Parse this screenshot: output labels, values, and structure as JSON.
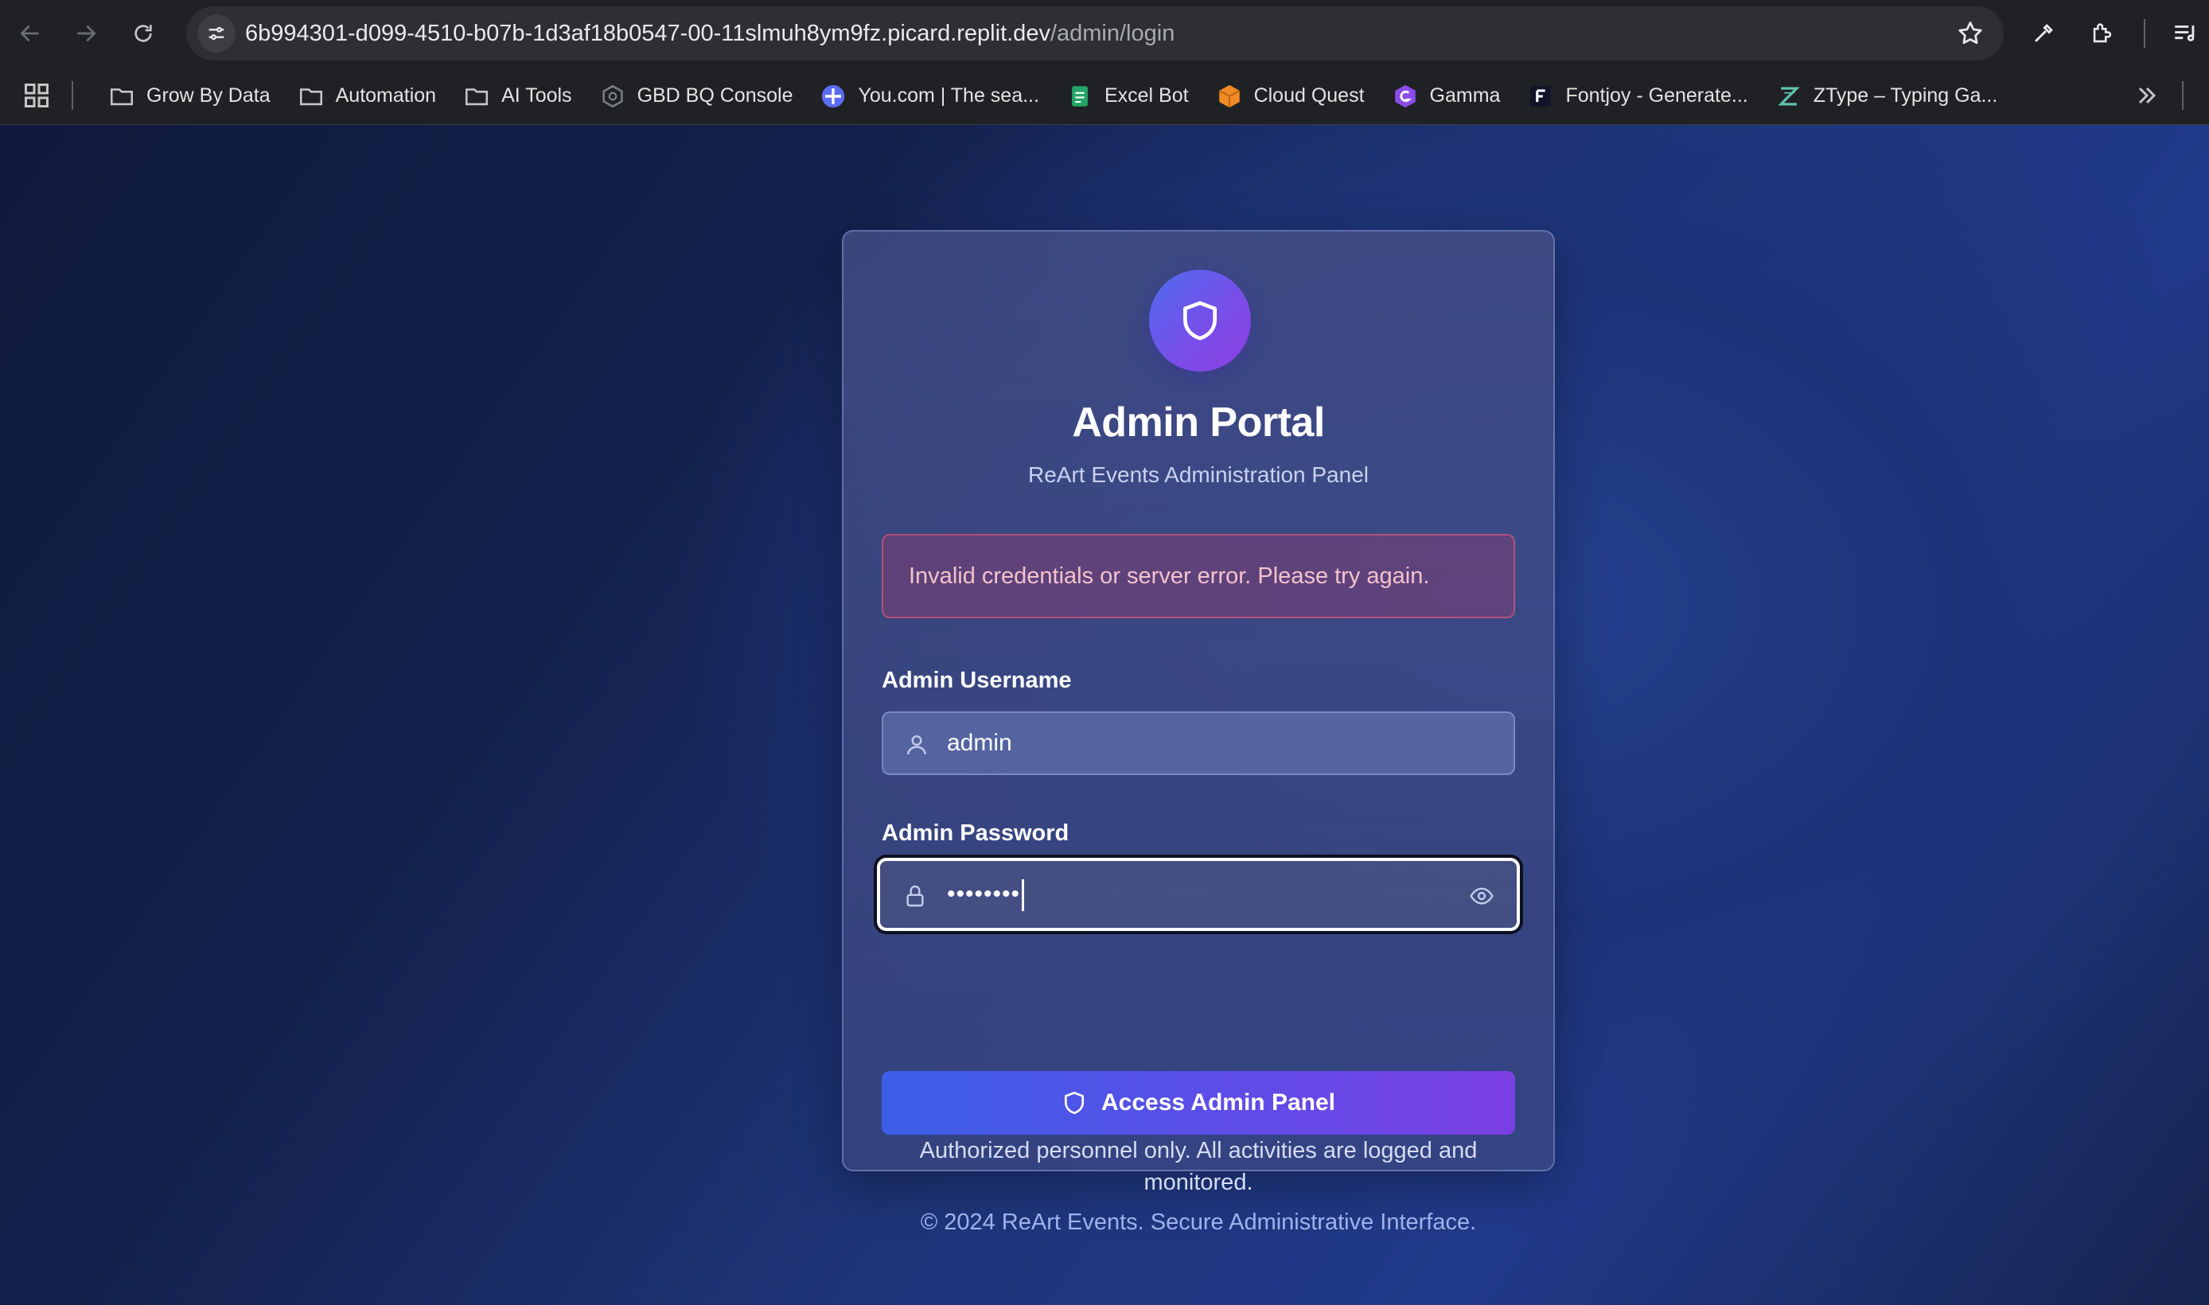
{
  "browser": {
    "url_host": "6b994301-d099-4510-b07b-1d3af18b0547-00-11slmuh8ym9fz.picard.replit.dev",
    "url_path": "/admin/login",
    "bookmarks": [
      {
        "label": "Grow By Data",
        "icon": "folder-icon"
      },
      {
        "label": "Automation",
        "icon": "folder-icon"
      },
      {
        "label": "AI Tools",
        "icon": "folder-icon"
      },
      {
        "label": "GBD BQ Console",
        "icon": "bigquery-icon"
      },
      {
        "label": "You.com | The sea...",
        "icon": "youcom-icon"
      },
      {
        "label": "Excel Bot",
        "icon": "sheet-icon"
      },
      {
        "label": "Cloud Quest",
        "icon": "cube-icon"
      },
      {
        "label": "Gamma",
        "icon": "gamma-icon"
      },
      {
        "label": "Fontjoy - Generate...",
        "icon": "fontjoy-icon"
      },
      {
        "label": "ZType – Typing Ga...",
        "icon": "ztype-icon"
      }
    ]
  },
  "login": {
    "title": "Admin Portal",
    "subtitle": "ReArt Events Administration Panel",
    "error": "Invalid credentials or server error. Please try again.",
    "username_label": "Admin Username",
    "username_value": "admin",
    "password_label": "Admin Password",
    "password_value": "••••••••",
    "submit_label": "Access Admin Panel",
    "notice": "Authorized personnel only. All activities are logged and monitored."
  },
  "footer": "© 2024 ReArt Events. Secure Administrative Interface.",
  "colors": {
    "accent_start": "#3a5fe6",
    "accent_end": "#7b3fe2",
    "error_border": "#dc5a78",
    "background": "#1e3579"
  }
}
